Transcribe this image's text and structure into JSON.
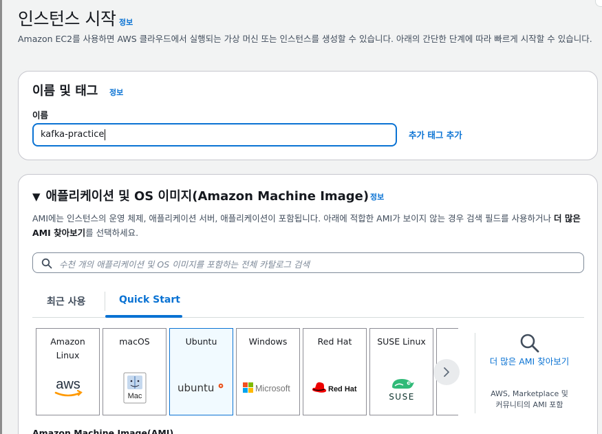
{
  "page": {
    "title": "인스턴스 시작",
    "info": "정보",
    "intro": "Amazon EC2를 사용하면 AWS 클라우드에서 실행되는 가상 머신 또는 인스턴스를 생성할 수 있습니다. 아래의 간단한 단계에 따라 빠르게 시작할 수 있습니다."
  },
  "name_tags": {
    "heading": "이름 및 태그",
    "info": "정보",
    "name_label": "이름",
    "name_value": "kafka-practice",
    "add_tags": "추가 태그 추가"
  },
  "ami": {
    "heading": "애플리케이션 및 OS 이미지(Amazon Machine Image)",
    "info": "정보",
    "desc_prefix": "AMI에는 인스턴스의 운영 체제, 애플리케이션 서버, 애플리케이션이 포함됩니다. 아래에 적합한 AMI가 보이지 않는 경우 검색 필드를 사용하거나 ",
    "desc_bold": "더 많은 AMI 찾아보기",
    "desc_suffix": "를 선택하세요.",
    "search_placeholder": "수천 개의 애플리케이션 및 OS 이미지를 포함하는 전체 카탈로그 검색",
    "tabs": [
      "최근 사용",
      "Quick Start"
    ],
    "selected_tab": "Quick Start",
    "tiles": [
      {
        "label": "Amazon Linux",
        "logo": "aws"
      },
      {
        "label": "macOS",
        "logo": "Mac"
      },
      {
        "label": "Ubuntu",
        "logo": "ubuntu"
      },
      {
        "label": "Windows",
        "logo": "Microsoft"
      },
      {
        "label": "Red Hat",
        "logo": "Red Hat"
      },
      {
        "label": "SUSE Linux",
        "logo": "SUSE"
      }
    ],
    "selected_tile": "Ubuntu",
    "more_link": "더 많은 AMI 찾아보기",
    "more_sub": "AWS, Marketplace 및 커뮤니티의 AMI 포함",
    "next_heading": "Amazon Machine Image(AMI)"
  },
  "colors": {
    "accent": "#0972d3",
    "selected_tile_bg": "#f1faff",
    "ubuntu_orange": "#e95420",
    "redhat_red": "#ee0000",
    "suse_green": "#30ba78"
  },
  "icons": [
    "search-icon",
    "chevron-right-icon",
    "caret-down-icon",
    "aws-logo",
    "mac-logo",
    "ubuntu-logo",
    "microsoft-logo",
    "redhat-logo",
    "suse-logo"
  ]
}
